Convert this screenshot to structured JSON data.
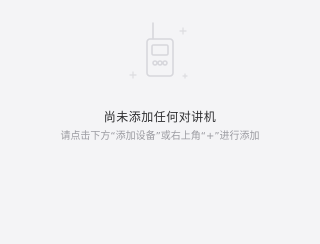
{
  "empty_state": {
    "icon": "walkie-talkie-icon",
    "sparkle_icon": "plus-sparkle-icon",
    "title": "尚未添加任何对讲机",
    "hint": "请点击下方“添加设备”或右上角“+”进行添加"
  },
  "colors": {
    "background": "#f4f4f6",
    "icon_stroke": "#d7d7dc",
    "title_text": "#2e2e30",
    "hint_text": "#9c9ca2"
  }
}
